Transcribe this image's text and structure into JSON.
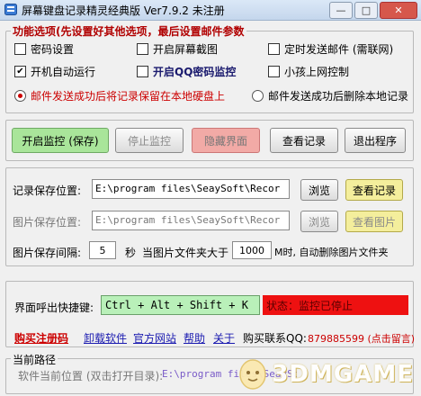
{
  "window": {
    "title": "屏幕键盘记录精灵经典版  Ver7.9.2  未注册",
    "minimize": "—",
    "maximize": "□",
    "close": "✕"
  },
  "options": {
    "group_title": "功能选项(先设置好其他选项，最后设置邮件参数",
    "password_setting": "密码设置",
    "screen_capture": "开启屏幕截图",
    "timed_email": "定时发送邮件 (需联网)",
    "auto_run": "开机自动运行",
    "qq_password_monitor": "开启QQ密码监控",
    "child_internet_control": "小孩上网控制",
    "keep_local": "邮件发送成功后将记录保留在本地硬盘上",
    "delete_local": "邮件发送成功后删除本地记录",
    "auto_run_checked": true,
    "keep_local_selected": true
  },
  "actions": {
    "start_monitor": "开启监控 (保存)",
    "stop_monitor": "停止监控",
    "hide_window": "隐藏界面",
    "view_records": "查看记录",
    "exit": "退出程序"
  },
  "record": {
    "save_label": "记录保存位置:",
    "save_path": "E:\\program files\\SeaySoft\\Recor",
    "browse": "浏览",
    "view": "查看记录"
  },
  "image": {
    "save_label": "图片保存位置:",
    "save_path": "E:\\program files\\SeaySoft\\Recor",
    "browse": "浏览",
    "view": "查看图片",
    "interval_label": "图片保存间隔:",
    "interval_value": "5",
    "interval_unit": "秒",
    "folder_limit_label": "当图片文件夹大于",
    "folder_limit_value": "1000",
    "folder_limit_unit": "M时, 自动删除图片文件夹"
  },
  "hotkey": {
    "label": "界面呼出快捷键:",
    "value": "Ctrl + Alt + Shift + K",
    "status": "状态：监控已停止"
  },
  "links": {
    "buy_register": "购买注册码",
    "uninstall": "卸载软件",
    "website": "官方网站",
    "help": "帮助",
    "about": "关于",
    "contact_label": "购买联系QQ:",
    "contact_value": "879885599 (点击留言)"
  },
  "path": {
    "group_title": "当前路径",
    "label": "软件当前位置 (双击打开目录):",
    "value": "E:\\program files\\SeaySoft\\Recor"
  },
  "watermark": {
    "text": "3DMGAME"
  },
  "colors": {
    "group_title": "#b10000",
    "green_button": "#a9e59a",
    "status_red": "#ee1111",
    "hotkey_green": "#b9f0b9",
    "link_blue": "#1a1ab0",
    "contact_red": "#cc0000"
  }
}
